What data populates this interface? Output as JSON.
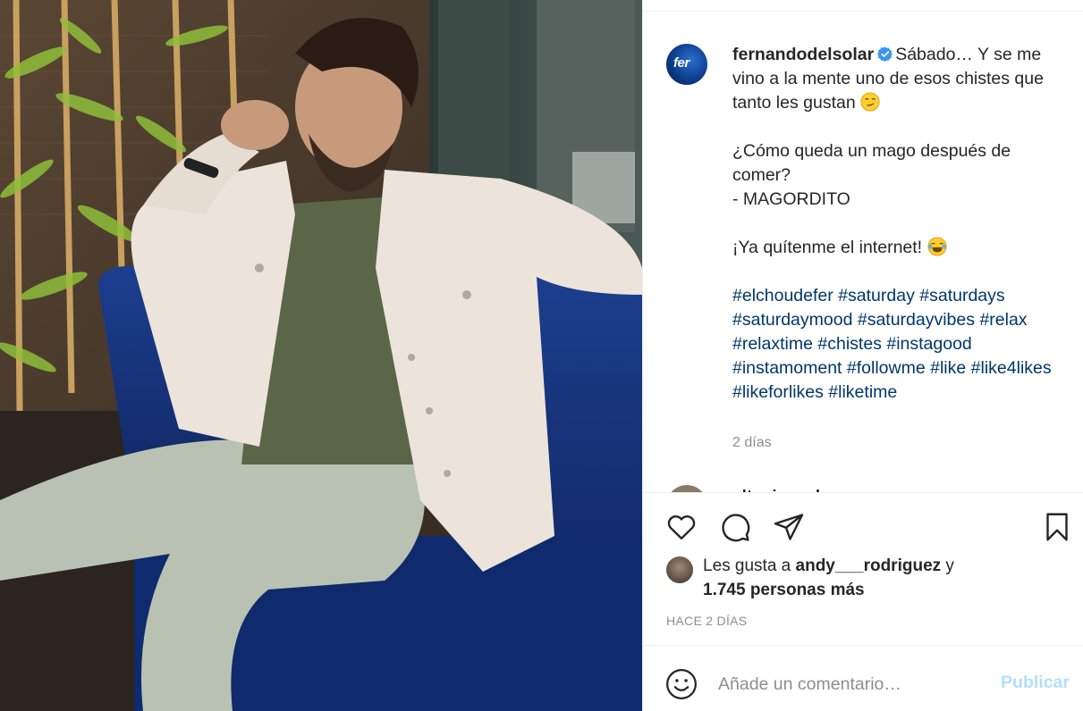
{
  "post": {
    "username": "fernandodelsolar",
    "avatar_text": "fer",
    "caption": {
      "line1": "Sábado… Y se me vino a la mente uno de esos chistes que tanto les gustan",
      "line2": "¿Cómo queda un mago después de comer?",
      "line3": "- MAGORDITO",
      "line4": "¡Ya quítenme el internet!"
    },
    "hashtags": [
      "#elchoudefer",
      "#saturday",
      "#saturdays",
      "#saturdaymood",
      "#saturdayvibes",
      "#relax",
      "#relaxtime",
      "#chistes",
      "#instagood",
      "#instamoment",
      "#followme",
      "#like",
      "#like4likes",
      "#likeforlikes",
      "#liketime"
    ],
    "caption_time": "2 días"
  },
  "comment_peek": {
    "username": "eltoxicoach",
    "more": "..."
  },
  "icons": {
    "like": "heart-icon",
    "comment": "comment-icon",
    "share": "paper-plane-icon",
    "save": "bookmark-icon",
    "emoji": "smiley-icon"
  },
  "likes": {
    "prefix": "Les gusta a",
    "liked_by": "andy___rodriguez",
    "conjunction": "y",
    "others": "1.745 personas más"
  },
  "date": "HACE 2 DÍAS",
  "comment_box": {
    "placeholder": "Añade un comentario…",
    "publish_label": "Publicar"
  },
  "colors": {
    "hashtag": "#00376b",
    "verified": "#3897f0",
    "publish_disabled": "#b2dffc",
    "muted": "#8e8e8e"
  }
}
